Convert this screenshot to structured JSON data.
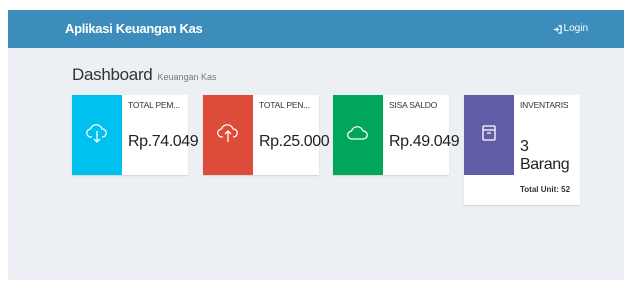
{
  "navbar": {
    "brand": "Aplikasi Keuangan Kas",
    "login_label": "Login",
    "color": "#3c8dbc"
  },
  "header": {
    "title": "Dashboard",
    "subtitle": "Keuangan Kas"
  },
  "boxes": [
    {
      "label": "TOTAL PEM...",
      "value": "Rp.74.049",
      "icon": "cloud-download-icon",
      "color": "#00c0ef"
    },
    {
      "label": "TOTAL PEN...",
      "value": "Rp.25.000",
      "icon": "cloud-upload-icon",
      "color": "#dd4b39"
    },
    {
      "label": "SISA SALDO",
      "value": "Rp.49.049",
      "icon": "cloud-icon",
      "color": "#00a65a"
    },
    {
      "label": "INVENTARIS",
      "value_line1": "3",
      "value_line2": "Barang",
      "footer": "Total Unit: 52",
      "icon": "archive-icon",
      "color": "#605ca8"
    }
  ]
}
